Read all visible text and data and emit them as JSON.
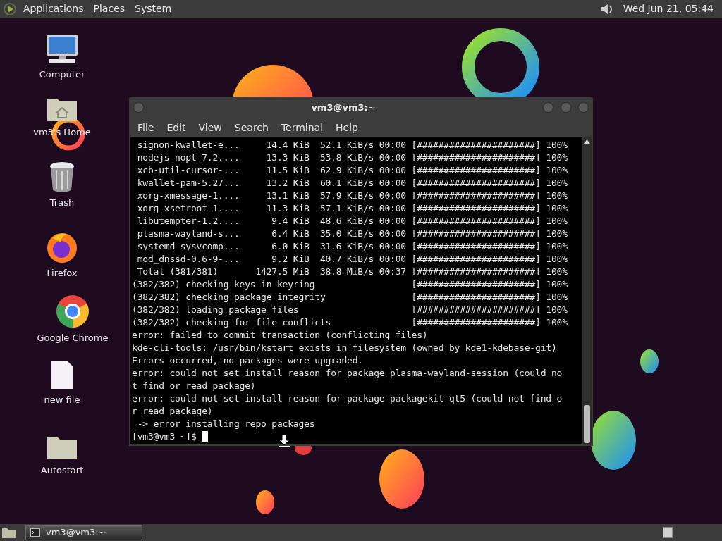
{
  "top_panel": {
    "menus": [
      "Applications",
      "Places",
      "System"
    ],
    "clock": "Wed Jun 21, 05:44"
  },
  "desktop_icons": [
    {
      "label": "Computer",
      "kind": "computer"
    },
    {
      "label": "vm3's Home",
      "kind": "home"
    },
    {
      "label": "Trash",
      "kind": "trash"
    },
    {
      "label": "Firefox",
      "kind": "firefox"
    },
    {
      "label": "Google Chrome",
      "kind": "chrome"
    },
    {
      "label": "new file",
      "kind": "file"
    },
    {
      "label": "Autostart",
      "kind": "folder"
    }
  ],
  "terminal": {
    "title": "vm3@vm3:~",
    "menu": [
      "File",
      "Edit",
      "View",
      "Search",
      "Terminal",
      "Help"
    ],
    "lines": [
      " signon-kwallet-e...     14.4 KiB  52.1 KiB/s 00:00 [######################] 100%",
      " nodejs-nopt-7.2....     13.3 KiB  53.8 KiB/s 00:00 [######################] 100%",
      " xcb-util-cursor-...     11.5 KiB  62.9 KiB/s 00:00 [######################] 100%",
      " kwallet-pam-5.27...     13.2 KiB  60.1 KiB/s 00:00 [######################] 100%",
      " xorg-xmessage-1....     13.1 KiB  57.9 KiB/s 00:00 [######################] 100%",
      " xorg-xsetroot-1....     11.3 KiB  57.1 KiB/s 00:00 [######################] 100%",
      " libutempter-1.2....      9.4 KiB  48.6 KiB/s 00:00 [######################] 100%",
      " plasma-wayland-s...      6.4 KiB  35.0 KiB/s 00:00 [######################] 100%",
      " systemd-sysvcomp...      6.0 KiB  31.6 KiB/s 00:00 [######################] 100%",
      " mod_dnssd-0.6-9-...      9.2 KiB  40.7 KiB/s 00:00 [######################] 100%",
      " Total (381/381)       1427.5 MiB  38.8 MiB/s 00:37 [######################] 100%",
      "(382/382) checking keys in keyring                  [######################] 100%",
      "(382/382) checking package integrity                [######################] 100%",
      "(382/382) loading package files                     [######################] 100%",
      "(382/382) checking for file conflicts               [######################] 100%",
      "error: failed to commit transaction (conflicting files)",
      "kde-cli-tools: /usr/bin/kstart exists in filesystem (owned by kde1-kdebase-git)",
      "Errors occurred, no packages were upgraded.",
      "error: could not set install reason for package plasma-wayland-session (could no",
      "t find or read package)",
      "error: could not set install reason for package packagekit-qt5 (could not find o",
      "r read package)",
      " -> error installing repo packages"
    ],
    "prompt": "[vm3@vm3 ~]$"
  },
  "taskbar": {
    "tasks": [
      {
        "label": "vm3@vm3:~",
        "selected": true
      }
    ]
  }
}
